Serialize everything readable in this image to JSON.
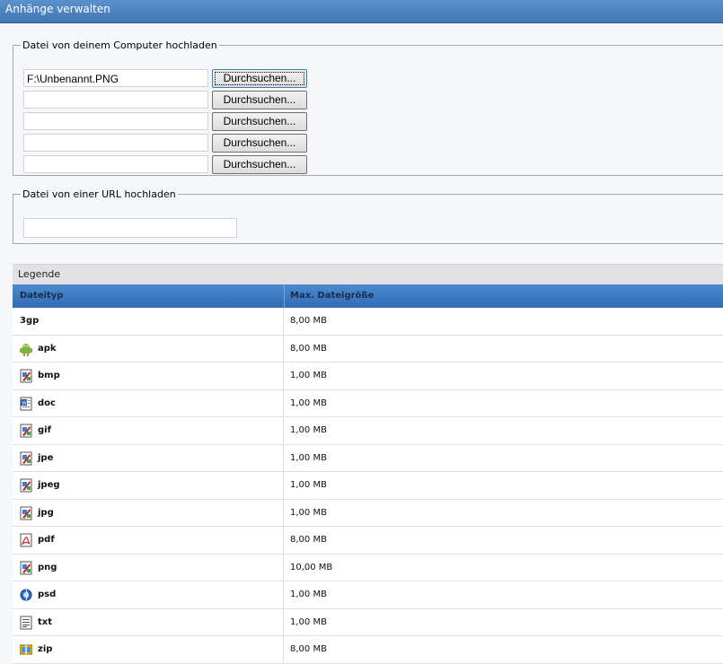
{
  "window": {
    "title": "Anhänge verwalten"
  },
  "upload_computer": {
    "legend": "Datei von deinem Computer hochladen",
    "button_label": "Durchsuchen...",
    "files": [
      "F:\\Unbenannt.PNG",
      "",
      "",
      "",
      ""
    ]
  },
  "upload_url": {
    "legend": "Datei von einer URL hochladen",
    "value": ""
  },
  "legend_table": {
    "title": "Legende",
    "headers": [
      "Dateityp",
      "Max. Dateigröße"
    ],
    "rows": [
      {
        "type": "3gp",
        "size": "8,00 MB",
        "icon": "none"
      },
      {
        "type": "apk",
        "size": "8,00 MB",
        "icon": "android-icon"
      },
      {
        "type": "bmp",
        "size": "1,00 MB",
        "icon": "image-icon"
      },
      {
        "type": "doc",
        "size": "1,00 MB",
        "icon": "word-icon"
      },
      {
        "type": "gif",
        "size": "1,00 MB",
        "icon": "image-icon"
      },
      {
        "type": "jpe",
        "size": "1,00 MB",
        "icon": "image-icon"
      },
      {
        "type": "jpeg",
        "size": "1,00 MB",
        "icon": "image-icon"
      },
      {
        "type": "jpg",
        "size": "1,00 MB",
        "icon": "image-icon"
      },
      {
        "type": "pdf",
        "size": "8,00 MB",
        "icon": "pdf-icon"
      },
      {
        "type": "png",
        "size": "10,00 MB",
        "icon": "image-icon"
      },
      {
        "type": "psd",
        "size": "1,00 MB",
        "icon": "photoshop-icon"
      },
      {
        "type": "txt",
        "size": "1,00 MB",
        "icon": "text-file-icon"
      },
      {
        "type": "zip",
        "size": "8,00 MB",
        "icon": "archive-icon"
      }
    ]
  }
}
